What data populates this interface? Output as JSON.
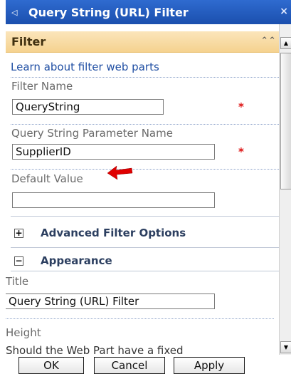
{
  "window": {
    "title": "Query String (URL) Filter",
    "menu_arrow": "◁",
    "close": "×"
  },
  "section": {
    "label": "Filter",
    "collapse_icon": "⌃⌃"
  },
  "learn_link": "Learn about filter web parts",
  "fields": {
    "filter_name": {
      "label": "Filter Name",
      "value": "QueryString",
      "required_mark": "*"
    },
    "param_name": {
      "label": "Query String Parameter Name",
      "value": "SupplierID",
      "required_mark": "*"
    },
    "default_value": {
      "label": "Default Value",
      "value": ""
    }
  },
  "groups": {
    "advanced": {
      "icon": "+",
      "label": "Advanced Filter Options"
    },
    "appearance": {
      "icon": "−",
      "label": "Appearance"
    }
  },
  "appearance": {
    "title_label": "Title",
    "title_value": "Query String (URL) Filter",
    "height_label": "Height",
    "height_question": "Should the Web Part have a fixed"
  },
  "buttons": {
    "ok": "OK",
    "cancel": "Cancel",
    "apply": "Apply"
  },
  "colors": {
    "titlebar": "#1b4fae",
    "section_header": "#f5d28f",
    "link": "#1f4ea3",
    "required": "#dd1111",
    "annotation_arrow": "#e00000"
  }
}
